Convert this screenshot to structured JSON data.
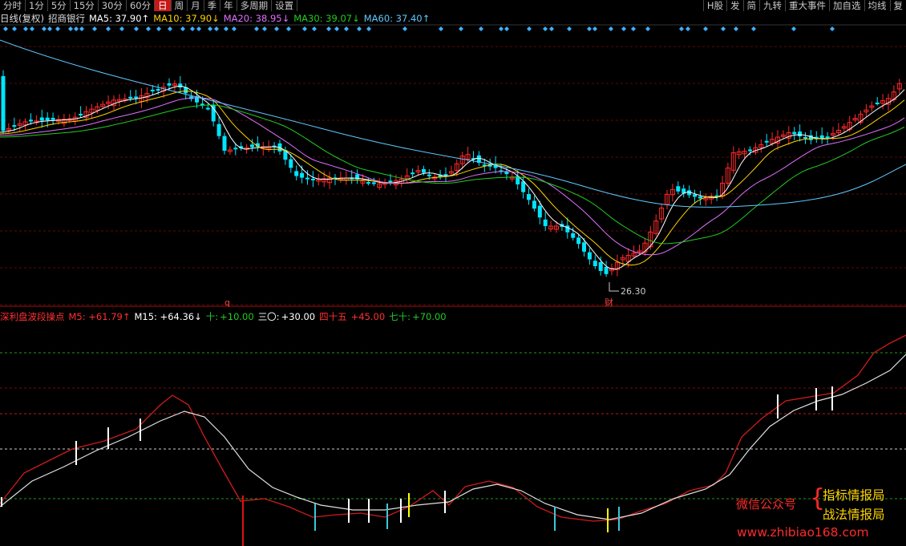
{
  "toolbar": {
    "left": [
      "分时",
      "1分",
      "5分",
      "15分",
      "30分",
      "60分",
      "日",
      "周",
      "月",
      "季",
      "年",
      "多周期",
      "设置"
    ],
    "active": "日",
    "right": [
      "H股",
      "发",
      "简",
      "九转",
      "重大事件",
      "加自选",
      "均线",
      "复"
    ]
  },
  "legend": {
    "name": "日线(复权)",
    "stock": "招商银行",
    "ma5": "MA5: 37.90↑",
    "ma10": "MA10: 37.90↓",
    "ma20": "MA20: 38.95↓",
    "ma30": "MA30: 39.07↓",
    "ma60": "MA60: 37.40↑"
  },
  "colors": {
    "ma5": "#ffffff",
    "ma10": "#ffd400",
    "ma20": "#e070ff",
    "ma30": "#22cc22",
    "ma60": "#5fc8ff",
    "up": "#ff2a2a",
    "down": "#00e5ff",
    "signal": "#ffff00",
    "grid": "#8b0000"
  },
  "price_annotations": {
    "low": "26.30",
    "financial_mark": "财",
    "q_mark": "q"
  },
  "indicator": {
    "name": "深利盘波段操点",
    "m5": "M5: +61.79↑",
    "m15": "M15: +64.36↓",
    "l10_label": "十:",
    "l10_value": "+10.00",
    "l30_label": "三〇:",
    "l30_value": "+30.00",
    "l45_label": "四十五",
    "l45_value": "+45.00",
    "l70_label": "七十:",
    "l70_value": "+70.00"
  },
  "watermark": {
    "wechat": "微信公众号",
    "brand1": "指标情报局",
    "brand2": "战法情报局",
    "url": "www.zhibiao168.com"
  }
}
